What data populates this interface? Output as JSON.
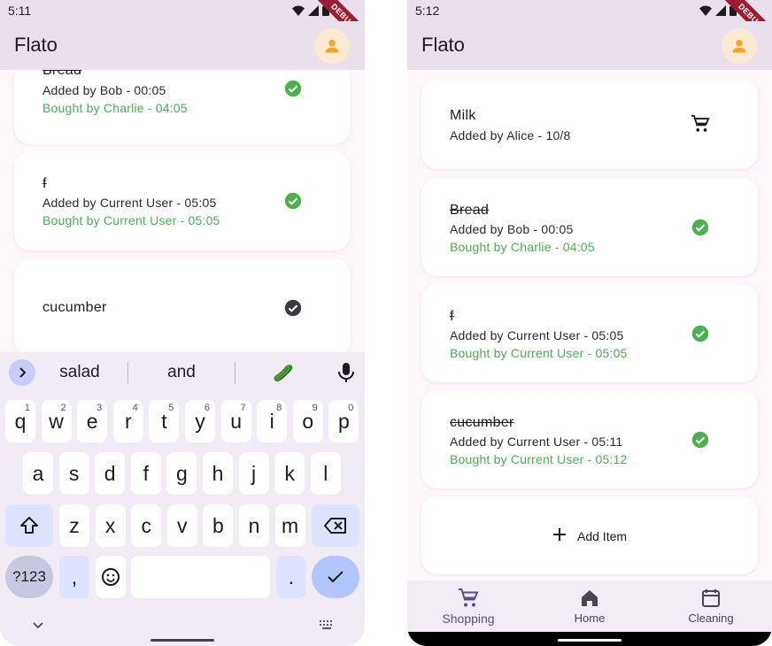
{
  "left": {
    "status_time": "5:11",
    "debug_label": "DEBUG",
    "app_title": "Flato",
    "items": [
      {
        "name": "Bread",
        "added": "Added by Bob - 00:05",
        "bought": "Bought by Charlie - 04:05"
      },
      {
        "name": "f",
        "added": "Added by Current User - 05:05",
        "bought": "Bought by Current User - 05:05"
      },
      {
        "name": "cucumber"
      }
    ],
    "keyboard": {
      "suggestions": [
        "salad",
        "and",
        "🥒"
      ],
      "row1": [
        "q",
        "w",
        "e",
        "r",
        "t",
        "y",
        "u",
        "i",
        "o",
        "p"
      ],
      "row1_hints": [
        "1",
        "2",
        "3",
        "4",
        "5",
        "6",
        "7",
        "8",
        "9",
        "0"
      ],
      "row2": [
        "a",
        "s",
        "d",
        "f",
        "g",
        "h",
        "j",
        "k",
        "l"
      ],
      "row3": [
        "z",
        "x",
        "c",
        "v",
        "b",
        "n",
        "m"
      ],
      "symbols_key": "?123",
      "comma_key": ",",
      "period_key": "."
    }
  },
  "right": {
    "status_time": "5:12",
    "debug_label": "DEBUG",
    "app_title": "Flato",
    "items": [
      {
        "name": "Milk",
        "added": "Added by Alice - 10/8"
      },
      {
        "name": "Bread",
        "added": "Added by Bob - 00:05",
        "bought": "Bought by Charlie - 04:05"
      },
      {
        "name": "f",
        "added": "Added by Current User - 05:05",
        "bought": "Bought by Current User - 05:05"
      },
      {
        "name": "cucumber",
        "added": "Added by Current User - 05:11",
        "bought": "Bought by Current User - 05:12"
      }
    ],
    "add_item_label": "Add Item",
    "nav": {
      "shopping": "Shopping",
      "home": "Home",
      "cleaning": "Cleaning"
    }
  },
  "colors": {
    "accent": "#5c4d8f",
    "bought_green": "#4caf50",
    "avatar_orange": "#f5a623",
    "app_bar": "#e9e0ec"
  },
  "icons": {
    "avatar": "person-icon",
    "bought": "check-circle-icon",
    "to_buy": "shopping-cart-icon",
    "add": "plus-icon"
  }
}
